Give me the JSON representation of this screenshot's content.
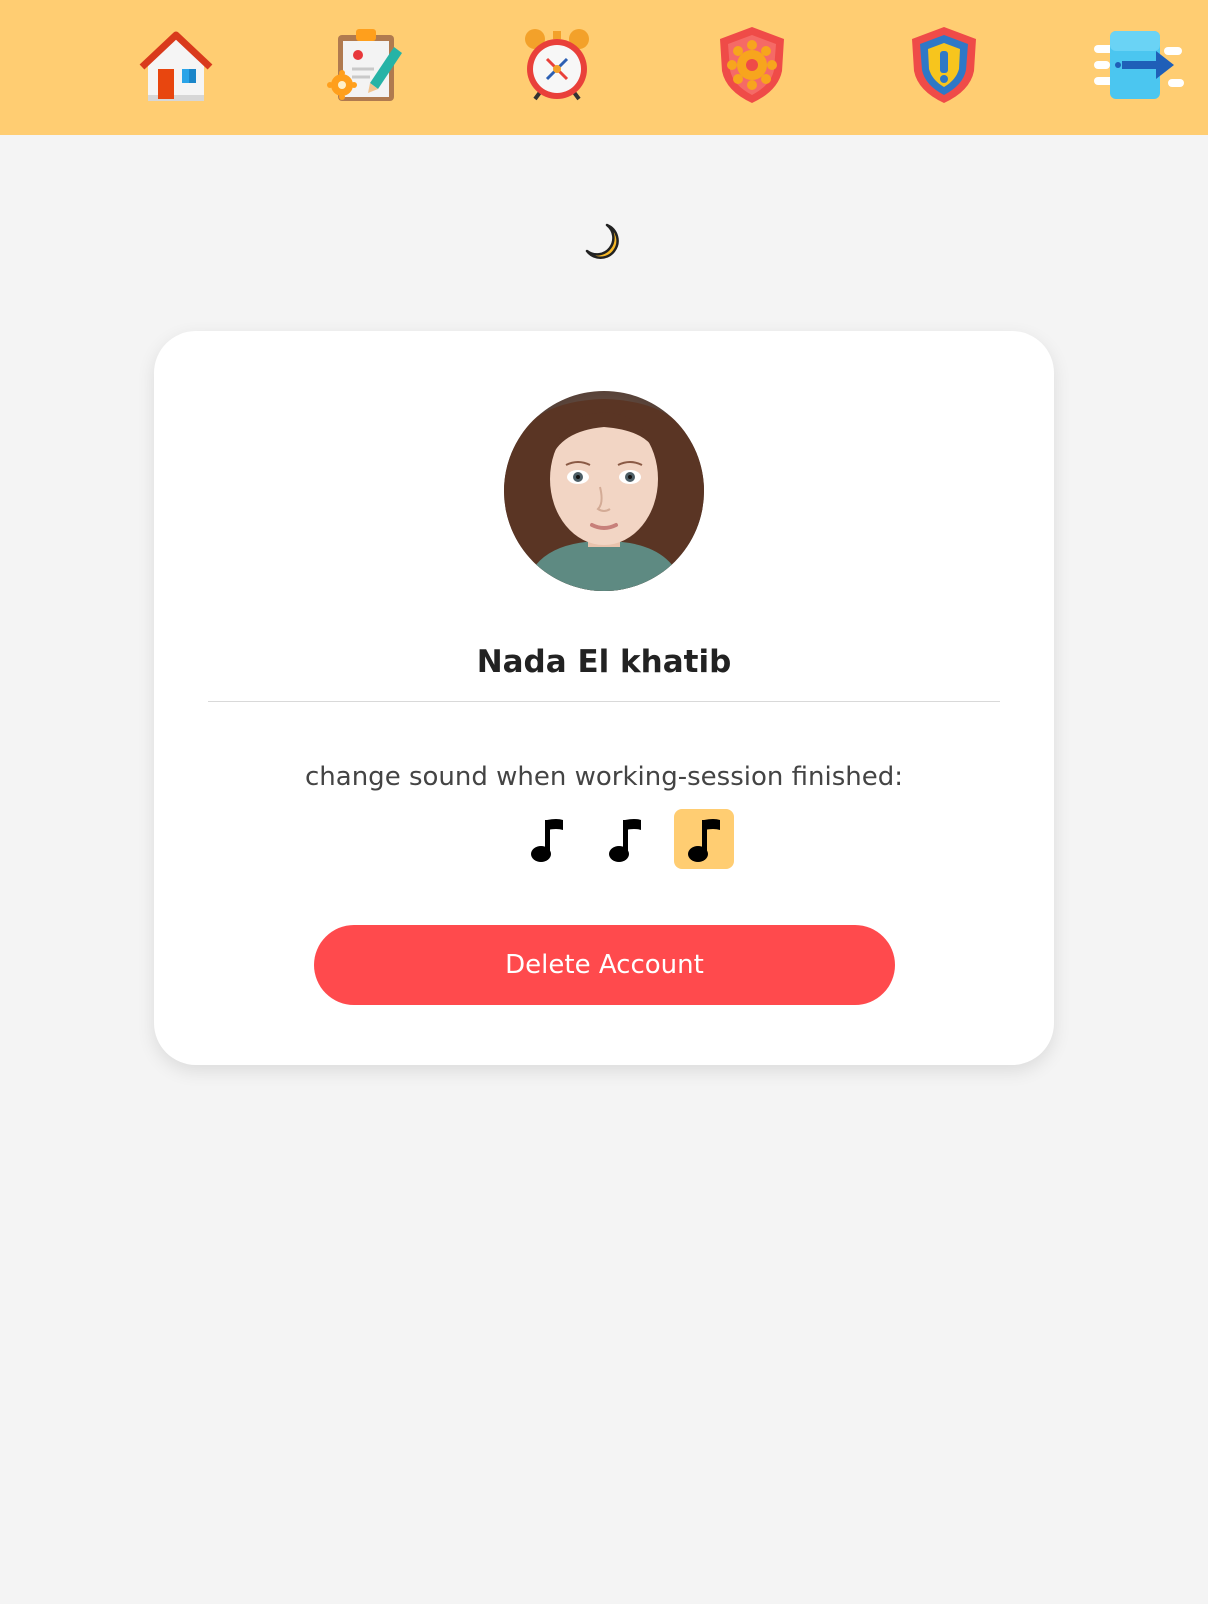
{
  "topbar": {
    "background": "#ffcd72",
    "items": [
      {
        "icon": "home-icon"
      },
      {
        "icon": "clipboard-settings-icon"
      },
      {
        "icon": "alarm-clock-icon"
      },
      {
        "icon": "shield-gear-icon"
      },
      {
        "icon": "shield-alert-icon"
      },
      {
        "icon": "logout-arrow-icon"
      }
    ]
  },
  "theme_toggle": {
    "icon": "moon-icon"
  },
  "profile": {
    "avatar_icon": "avatar",
    "name": "Nada El khatib",
    "sound_label": "change sound when working-session finished:",
    "sound_options": [
      {
        "icon": "music-note-icon",
        "selected": false
      },
      {
        "icon": "music-note-icon",
        "selected": false
      },
      {
        "icon": "music-note-icon",
        "selected": true
      }
    ],
    "delete_label": "Delete Account"
  },
  "colors": {
    "accent": "#ffcd72",
    "danger": "#ff4a4d",
    "background": "#f4f4f4",
    "card": "#ffffff"
  }
}
